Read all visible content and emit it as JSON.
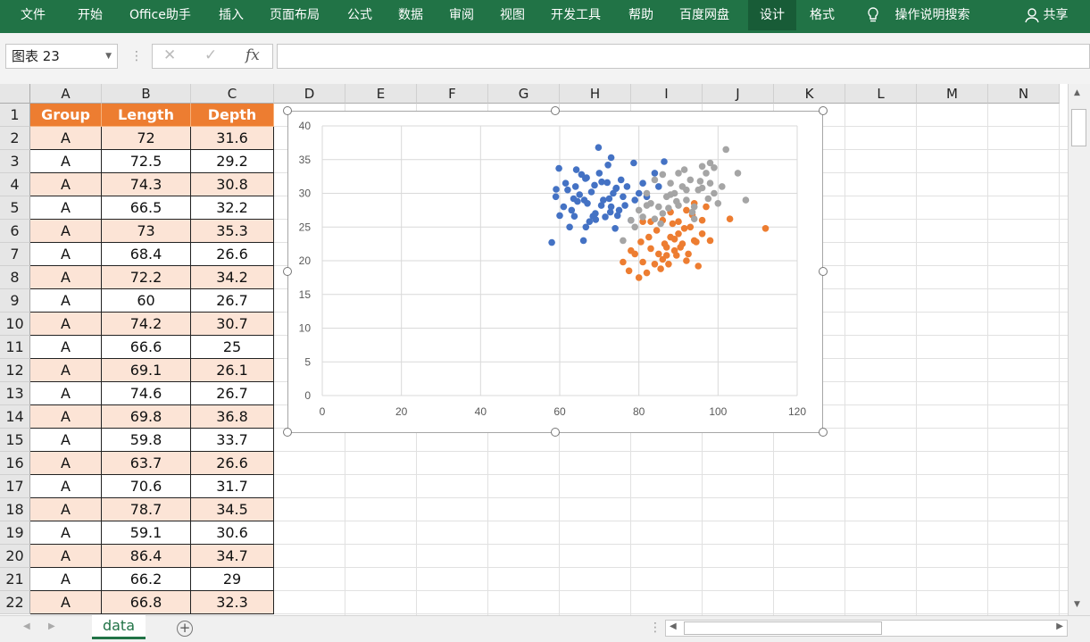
{
  "ribbon": {
    "tabs": [
      "文件",
      "开始",
      "Office助手",
      "插入",
      "页面布局",
      "公式",
      "数据",
      "审阅",
      "视图",
      "开发工具",
      "帮助",
      "百度网盘",
      "设计",
      "格式"
    ],
    "search": "操作说明搜索",
    "share": "共享"
  },
  "formula_bar": {
    "name_box": "图表 23",
    "fx": "fx",
    "value": ""
  },
  "columns": [
    "A",
    "B",
    "C",
    "D",
    "E",
    "F",
    "G",
    "H",
    "I",
    "J",
    "K",
    "L",
    "M",
    "N"
  ],
  "rows": [
    "1",
    "2",
    "3",
    "4",
    "5",
    "6",
    "7",
    "8",
    "9",
    "10",
    "11",
    "12",
    "13",
    "14",
    "15",
    "16",
    "17",
    "18",
    "19",
    "20",
    "21",
    "22"
  ],
  "table": {
    "headers": [
      "Group",
      "Length",
      "Depth"
    ],
    "rows": [
      [
        "A",
        "72",
        "31.6"
      ],
      [
        "A",
        "72.5",
        "29.2"
      ],
      [
        "A",
        "74.3",
        "30.8"
      ],
      [
        "A",
        "66.5",
        "32.2"
      ],
      [
        "A",
        "73",
        "35.3"
      ],
      [
        "A",
        "68.4",
        "26.6"
      ],
      [
        "A",
        "72.2",
        "34.2"
      ],
      [
        "A",
        "60",
        "26.7"
      ],
      [
        "A",
        "74.2",
        "30.7"
      ],
      [
        "A",
        "66.6",
        "25"
      ],
      [
        "A",
        "69.1",
        "26.1"
      ],
      [
        "A",
        "74.6",
        "26.7"
      ],
      [
        "A",
        "69.8",
        "36.8"
      ],
      [
        "A",
        "59.8",
        "33.7"
      ],
      [
        "A",
        "63.7",
        "26.6"
      ],
      [
        "A",
        "70.6",
        "31.7"
      ],
      [
        "A",
        "78.7",
        "34.5"
      ],
      [
        "A",
        "59.1",
        "30.6"
      ],
      [
        "A",
        "86.4",
        "34.7"
      ],
      [
        "A",
        "66.2",
        "29"
      ],
      [
        "A",
        "66.8",
        "32.3"
      ]
    ]
  },
  "sheet": {
    "tab": "data"
  },
  "chart_data": {
    "type": "scatter",
    "xlim": [
      0,
      120
    ],
    "ylim": [
      0,
      40
    ],
    "xticks": [
      "0",
      "20",
      "40",
      "60",
      "80",
      "100",
      "120"
    ],
    "yticks": [
      "0",
      "5",
      "10",
      "15",
      "20",
      "25",
      "30",
      "35",
      "40"
    ],
    "grid": true,
    "series": [
      {
        "color": "#4472c4",
        "points": [
          [
            72,
            31.6
          ],
          [
            72.5,
            29.2
          ],
          [
            74.3,
            30.8
          ],
          [
            66.5,
            32.2
          ],
          [
            73,
            35.3
          ],
          [
            68.4,
            26.6
          ],
          [
            72.2,
            34.2
          ],
          [
            60,
            26.7
          ],
          [
            74.2,
            30.7
          ],
          [
            66.6,
            25
          ],
          [
            69.1,
            26.1
          ],
          [
            74.6,
            26.7
          ],
          [
            69.8,
            36.8
          ],
          [
            59.8,
            33.7
          ],
          [
            63.7,
            26.6
          ],
          [
            70.6,
            31.7
          ],
          [
            78.7,
            34.5
          ],
          [
            59.1,
            30.6
          ],
          [
            86.4,
            34.7
          ],
          [
            66.2,
            29
          ],
          [
            66.8,
            32.3
          ],
          [
            58,
            22.7
          ],
          [
            59,
            29.5
          ],
          [
            61,
            28
          ],
          [
            62,
            30.5
          ],
          [
            63,
            27.5
          ],
          [
            64,
            31
          ],
          [
            65,
            29.8
          ],
          [
            66,
            23
          ],
          [
            67,
            28.5
          ],
          [
            68,
            30.2
          ],
          [
            69,
            27
          ],
          [
            70,
            33
          ],
          [
            71,
            29
          ],
          [
            71.5,
            26.5
          ],
          [
            73,
            28
          ],
          [
            73.5,
            30
          ],
          [
            74,
            24.8
          ],
          [
            75,
            27.5
          ],
          [
            76,
            29.5
          ],
          [
            77,
            31
          ],
          [
            78,
            26
          ],
          [
            79,
            29
          ],
          [
            80,
            30
          ],
          [
            81,
            31.5
          ],
          [
            82,
            29.5
          ],
          [
            84,
            33
          ],
          [
            85,
            31
          ],
          [
            62.5,
            25
          ],
          [
            64.5,
            28.8
          ],
          [
            65.5,
            32.8
          ],
          [
            67.5,
            25.8
          ],
          [
            70.5,
            28.2
          ],
          [
            72.8,
            27.2
          ],
          [
            75.5,
            32
          ],
          [
            61.5,
            31.5
          ],
          [
            63.5,
            29.2
          ],
          [
            68.8,
            31.2
          ],
          [
            76.5,
            28.2
          ],
          [
            64.2,
            33.5
          ]
        ]
      },
      {
        "color": "#ed7d31",
        "points": [
          [
            80,
            17.5
          ],
          [
            82,
            18.2
          ],
          [
            84,
            19.5
          ],
          [
            85,
            21
          ],
          [
            86,
            20.2
          ],
          [
            87,
            22
          ],
          [
            88,
            23.5
          ],
          [
            89,
            21.5
          ],
          [
            90,
            24
          ],
          [
            91,
            22.5
          ],
          [
            92,
            20
          ],
          [
            93,
            25
          ],
          [
            94,
            23
          ],
          [
            95,
            19.2
          ],
          [
            96,
            26
          ],
          [
            97,
            28
          ],
          [
            98,
            23
          ],
          [
            103,
            26.2
          ],
          [
            112,
            24.8
          ],
          [
            79,
            21
          ],
          [
            80.5,
            22.8
          ],
          [
            81,
            19.8
          ],
          [
            82.5,
            23.5
          ],
          [
            83,
            21.8
          ],
          [
            84.5,
            24.5
          ],
          [
            85.5,
            18.8
          ],
          [
            86.5,
            22.5
          ],
          [
            87.5,
            19.5
          ],
          [
            88.5,
            25.5
          ],
          [
            89.5,
            20.8
          ],
          [
            90.5,
            22
          ],
          [
            91.5,
            24.8
          ],
          [
            92.5,
            21
          ],
          [
            93.5,
            26.8
          ],
          [
            94.5,
            22.8
          ],
          [
            76,
            19.8
          ],
          [
            78,
            21.5
          ],
          [
            77.5,
            18.5
          ],
          [
            86,
            26
          ],
          [
            88,
            27.2
          ],
          [
            90,
            25.8
          ],
          [
            92,
            27.5
          ],
          [
            94,
            28.5
          ],
          [
            96,
            24
          ],
          [
            83,
            25.8
          ],
          [
            81,
            25.8
          ],
          [
            89,
            23.2
          ],
          [
            87,
            20.8
          ]
        ]
      },
      {
        "color": "#a5a5a5",
        "points": [
          [
            78,
            26
          ],
          [
            80,
            27.5
          ],
          [
            82,
            30
          ],
          [
            84,
            32
          ],
          [
            85,
            28
          ],
          [
            86,
            27
          ],
          [
            87,
            29.5
          ],
          [
            88,
            31.5
          ],
          [
            89,
            30
          ],
          [
            90,
            33
          ],
          [
            91,
            31
          ],
          [
            92,
            29
          ],
          [
            93,
            32
          ],
          [
            94,
            28
          ],
          [
            95,
            30.5
          ],
          [
            96,
            34
          ],
          [
            97,
            33
          ],
          [
            98,
            31.5
          ],
          [
            99,
            30
          ],
          [
            100,
            28.5
          ],
          [
            102,
            36.5
          ],
          [
            105,
            33
          ],
          [
            107,
            29
          ],
          [
            76,
            23
          ],
          [
            79,
            25
          ],
          [
            81,
            26.5
          ],
          [
            83,
            28.5
          ],
          [
            85.5,
            25.5
          ],
          [
            87.5,
            27.8
          ],
          [
            89.5,
            28.8
          ],
          [
            91.5,
            33.5
          ],
          [
            93.5,
            27.2
          ],
          [
            95.5,
            31.8
          ],
          [
            97.5,
            29.2
          ],
          [
            99,
            33.8
          ],
          [
            101,
            31
          ],
          [
            86,
            32.8
          ],
          [
            88,
            29.8
          ],
          [
            90,
            28.2
          ],
          [
            92,
            30.5
          ],
          [
            94,
            26.2
          ],
          [
            96,
            30.8
          ],
          [
            98,
            34.5
          ],
          [
            84,
            26.2
          ],
          [
            82,
            28.2
          ]
        ]
      }
    ]
  }
}
